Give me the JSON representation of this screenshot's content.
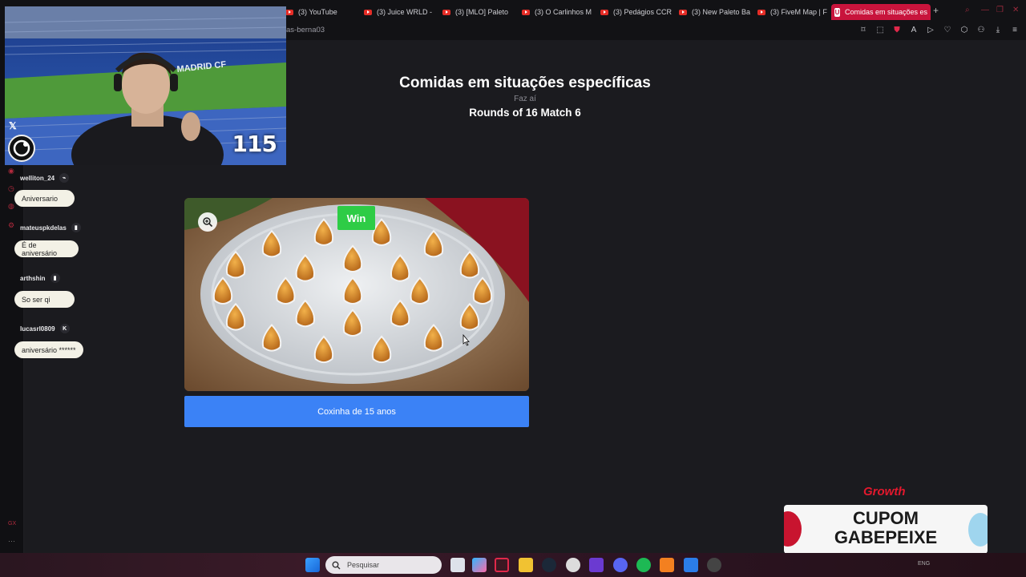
{
  "browser": {
    "tabs": [
      {
        "label": "(3) YouTube",
        "active": false
      },
      {
        "label": "(3) Juice WRLD -",
        "active": false
      },
      {
        "label": "(3) [MLO] Paleto",
        "active": false
      },
      {
        "label": "(3) O Carlinhos M",
        "active": false
      },
      {
        "label": "(3) Pedágios CCR",
        "active": false
      },
      {
        "label": "(3) New Paleto Ba",
        "active": false
      },
      {
        "label": "(3) FiveM Map | F",
        "active": false
      },
      {
        "label": "Comidas em situações es",
        "active": true
      }
    ],
    "url_fragment": "as-berna03"
  },
  "page": {
    "title": "Comidas em situações específicas",
    "subtitle": "Faz aí",
    "round": "Rounds of 16 Match 6",
    "win_badge": "Win",
    "choice_label": "Coxinha de 15 anos"
  },
  "stream_overlay": {
    "counter": "115",
    "chat": [
      {
        "user": "welliton_24",
        "message": "Aniversario"
      },
      {
        "user": "mateuspkdelas",
        "message": "É de aniversário"
      },
      {
        "user": "arthshin",
        "message": "So ser qi"
      },
      {
        "user": "lucasrl0809",
        "message": "aniversário ******"
      }
    ],
    "sponsor_brand": "Growth",
    "coupon_line1": "CUPOM",
    "coupon_line2": "GABEPEIXE"
  },
  "taskbar": {
    "search_placeholder": "Pesquisar",
    "tray_lang": "ENG"
  },
  "colors": {
    "accent_tab": "#c8143c",
    "choice_button": "#3b82f6",
    "win_badge": "#2ecc46"
  }
}
